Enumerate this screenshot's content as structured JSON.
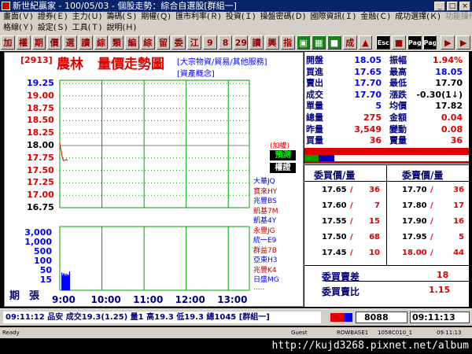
{
  "window": {
    "title": "新世紀贏家 - 100/05/03 - 個股走勢：綜合自選股[群組一]"
  },
  "menu": {
    "row1": [
      "畫面(Ｖ)",
      "證券(Ｅ)",
      "主力(Ｕ)",
      "籌碼(Ｓ)",
      "期權(Ｑ)",
      "匯市利率(Ｒ)",
      "投資(Ｉ)",
      "操盤密碼(Ｄ)",
      "國際資訊(Ｉ)",
      "金融(Ｃ)",
      "成功選擇(Ｋ)",
      "功能操作(Ｐ)"
    ],
    "row2": [
      "格線(Ｙ)",
      "設定(Ｓ)",
      "工具(Ｔ)",
      "說明(Ｈ)"
    ]
  },
  "toolbar": {
    "buttons": [
      "加",
      "權",
      "期",
      "價",
      "選",
      "讀",
      "綜",
      "類",
      "編",
      "綜",
      "留",
      "委",
      "江",
      "9",
      "8",
      "29",
      "讀",
      "興",
      "指",
      "▣",
      "▦",
      "■",
      "成",
      "▲",
      "Esc",
      "■",
      "Page Up",
      "Page Down",
      "▶",
      "▶"
    ]
  },
  "chart": {
    "stock_code": "[2913]",
    "stock_name": "農林",
    "chart_title": "量價走勢圖",
    "tags_line1": "[大宗物資/貿易/其他服務]",
    "tags_line2": "[資產概念]",
    "price_ticks": [
      "19.25",
      "19.00",
      "18.75",
      "18.50",
      "18.25",
      "18.00",
      "17.75",
      "17.50",
      "17.25",
      "17.00",
      "16.75"
    ],
    "volume_ticks": [
      "3,000",
      "1,000",
      "500",
      "100",
      "50",
      "15"
    ],
    "volume_axis_label": "張",
    "period_label": "期",
    "time_ticks": [
      "9:00",
      "10:00",
      "11:00",
      "12:00",
      "13:00"
    ],
    "right_tag": "(加權)",
    "forecast_label": "預測",
    "brokers_label": "權證",
    "brokers": [
      "大華JQ",
      "寶來HY",
      "兆豐BS",
      "凱基7M",
      "凱基4Y",
      "永豐JG",
      "統一E9",
      "群益7B",
      "亞東H3",
      "兆豐K4",
      "日盛MG",
      "....."
    ]
  },
  "chart_data": {
    "type": "line",
    "series": [
      {
        "x": [
          "9:00",
          "9:01",
          "9:02",
          "9:03",
          "9:04",
          "9:05",
          "9:07",
          "9:09",
          "9:11"
        ],
        "values": [
          18.05,
          17.95,
          17.9,
          17.8,
          17.75,
          17.7,
          17.7,
          17.72,
          17.7
        ]
      }
    ],
    "volume": {
      "x": [
        "9:00",
        "9:01",
        "9:02",
        "9:03",
        "9:04",
        "9:05",
        "9:06",
        "9:07",
        "9:08",
        "9:09",
        "9:10",
        "9:11"
      ],
      "values": [
        25,
        14,
        18,
        22,
        16,
        12,
        20,
        15,
        18,
        14,
        16,
        30
      ]
    },
    "ylim": [
      16.75,
      19.25
    ],
    "reference_price": 18.0,
    "xlabel": "",
    "ylabel": ""
  },
  "quote": {
    "left": [
      {
        "label": "開盤",
        "value": "18.05",
        "color": "#0000ff"
      },
      {
        "label": "買進",
        "value": "17.65",
        "color": "#0000ff"
      },
      {
        "label": "賣出",
        "value": "17.70",
        "color": "#0000ff"
      },
      {
        "label": "成交",
        "value": "17.70",
        "color": "#0000ff"
      },
      {
        "label": "單量",
        "value": "5",
        "color": "#0000ff"
      },
      {
        "label": "總量",
        "value": "275",
        "color": "#e00000"
      },
      {
        "label": "昨量",
        "value": "3,549",
        "color": "#e00000"
      },
      {
        "label": "買量",
        "value": "36",
        "color": "#e00000"
      }
    ],
    "right": [
      {
        "label": "振幅",
        "value": "1.94%",
        "color": "#e00000"
      },
      {
        "label": "最高",
        "value": "18.05",
        "color": "#0000ff"
      },
      {
        "label": "最低",
        "value": "17.70",
        "color": "#000000"
      },
      {
        "label": "漲跌",
        "value": "-0.30(1↓)",
        "color": "#000000"
      },
      {
        "label": "均價",
        "value": "17.82",
        "color": "#000000"
      },
      {
        "label": "金額",
        "value": "0.04",
        "color": "#e00000"
      },
      {
        "label": "變動",
        "value": "0.08",
        "color": "#e00000"
      },
      {
        "label": "賣量",
        "value": "36",
        "color": "#e00000"
      }
    ],
    "bid_header": "委買價/量",
    "ask_header": "委賣價/量",
    "bids": [
      {
        "price": "17.65",
        "qty": "36"
      },
      {
        "price": "17.60",
        "qty": "7"
      },
      {
        "price": "17.55",
        "qty": "15"
      },
      {
        "price": "17.50",
        "qty": "68"
      },
      {
        "price": "17.45",
        "qty": "10"
      }
    ],
    "asks": [
      {
        "price": "17.70",
        "qty": "36"
      },
      {
        "price": "17.80",
        "qty": "17"
      },
      {
        "price": "17.90",
        "qty": "16"
      },
      {
        "price": "17.95",
        "qty": "5"
      },
      {
        "price": "18.00",
        "qty": "44"
      }
    ],
    "diff_label": "委買賣差",
    "diff_value": "18",
    "ratio_label": "委買賣比",
    "ratio_value": "1.15"
  },
  "status": {
    "ticker": "09:11:12 品安 成交19.3(1.25) 量1 高19.3 低19.3 總1045 [群組一]",
    "code_box": "8088",
    "clock": "09:11:13"
  },
  "bottom": {
    "cells": [
      "Ready",
      "Guest",
      "ROWBASE1",
      "1058C010_1",
      "09:11:13"
    ]
  },
  "taskbar": {
    "url": "http://kujd3268.pixnet.net/album"
  }
}
